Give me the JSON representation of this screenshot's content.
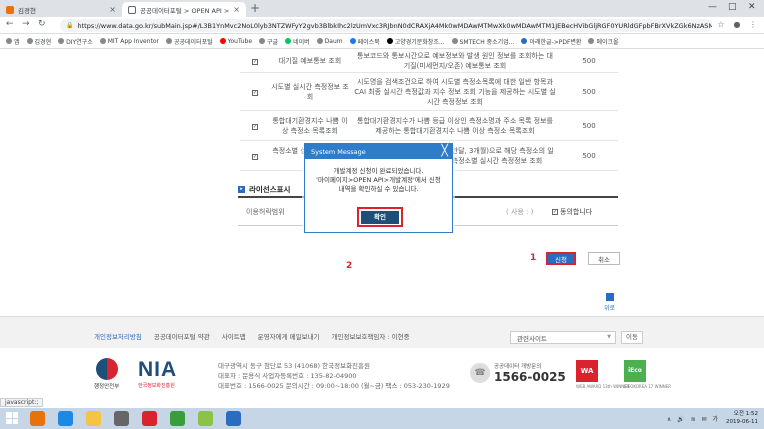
{
  "browser": {
    "tabs": [
      {
        "title": "김경현",
        "close": "×"
      },
      {
        "title": "공공데이터포털 > OPEN API >",
        "close": "×"
      }
    ],
    "new_tab": "+",
    "window_controls": [
      "—",
      "□",
      "✕"
    ],
    "url": "https://www.data.go.kr/subMain.jsp#/L3B1YnMvc2NoL0lyb3NTZWFyY2gvb3BlbkIhc2lzUmVxc3RJbnN0dCRAXjA4Mk0wMDAwMTMwXk0wMDAwMTM1JEBecHVibGljRGF0YURldGFpbFBrXVkZGk6NzASM..."
  },
  "bookmarks": [
    "앱",
    "김경현",
    "DIY연구소",
    "MIT App Inventor",
    "공공데이터포털",
    "YouTube",
    "구글",
    "네이버",
    "Daum",
    "페이스북",
    "고양경기문화창조...",
    "SMTECH 중소기업...",
    "아래한글->PDF변환",
    "메이크올"
  ],
  "api_table": {
    "rows": [
      {
        "name": "대기질 예보통보 조회",
        "desc": "통보코드와 통보시간으로 예보정보와 발생 원인 정보를 조회하는 대기질(미세먼지/오존) 예보통보 조회",
        "count": "500"
      },
      {
        "name": "시도별 실시간 측정정보 조회",
        "desc": "시도명을 검색조건으로 하여 시도별 측정소목록에 대한 일반 항목과 CAI 최종 실시간 측정값과 지수 정보 조회 기능을 제공하는 시도별 실시간 측정정보 조회",
        "count": "500"
      },
      {
        "name": "통합대기환경지수 나쁨 이상 측정소 목록조회",
        "desc": "통합대기환경지수가 나쁨 등급 이상인 측정소명과 주소 목록 정보를 제공하는 통합대기환경지수 나쁨 이상 측정소 목록조회",
        "count": "500"
      },
      {
        "name": "측정소별 실시간 측정정보 조회",
        "desc": "측정소명과 측정데이터 기간(일, 한달, 3개월)으로 해당 측정소의 일반항목 측정정보를 제공하는 측정소별 실시간 측정정보 조회",
        "count": "500"
      }
    ]
  },
  "license": {
    "section_title": "라이선스표시",
    "row_label": "이용허락범위",
    "select_value": "( 사용 : )",
    "agree_label": "동의합니다"
  },
  "actions": {
    "apply": "신청",
    "cancel": "취소",
    "marker1": "1",
    "marker2": "2",
    "top_label": "위로"
  },
  "modal": {
    "title": "System Message",
    "close": "╳",
    "message_line1": "개발계정 신청이 완료되었습니다.",
    "message_line2": "'마이페이지>OPEN API>개발계정'에서 신청",
    "message_line3": "내역을 확인하실 수 있습니다.",
    "ok": "확인"
  },
  "footer": {
    "links": [
      "개인정보처리방침",
      "공공데이터포털 약관",
      "사이트맵",
      "운영자에게 메일보내기",
      "개인정보보호책임자 : 이현중"
    ],
    "related_select": "관련사이트",
    "go_button": "이동",
    "gov_label": "행정안전부",
    "nia_logo": "NIA",
    "nia_sub": "한국정보화진흥원",
    "address_line1": "대구광역시 동구 첨단로 53 (41068) 한국정보화진흥원",
    "address_line2": "대표자 : 문용식  사업자등록번호 : 135-82-04900",
    "address_line3": "대표번호 : 1566-0025   문의시간 : 09:00~18:00 (월~금) 팩스 : 053-230-1929",
    "call_label": "공공데이터 개방문의",
    "call_number": "1566-0025",
    "award1": "WA",
    "award1_sub": "WEB AWARD 13th WINNER",
    "award2": "iEco",
    "award2_sub": "IEEOKOREA 17 WINNER"
  },
  "status_bar": "javascript:;",
  "taskbar": {
    "time": "오전 1:52",
    "date": "2019-06-11",
    "tray": "∧ 🔊 ≋ ✉ 가"
  },
  "colors": {
    "accent": "#2a6cbf",
    "modal_header": "#2f7dc8",
    "highlight": "#d9232e",
    "ok_button": "#1f4e79"
  }
}
